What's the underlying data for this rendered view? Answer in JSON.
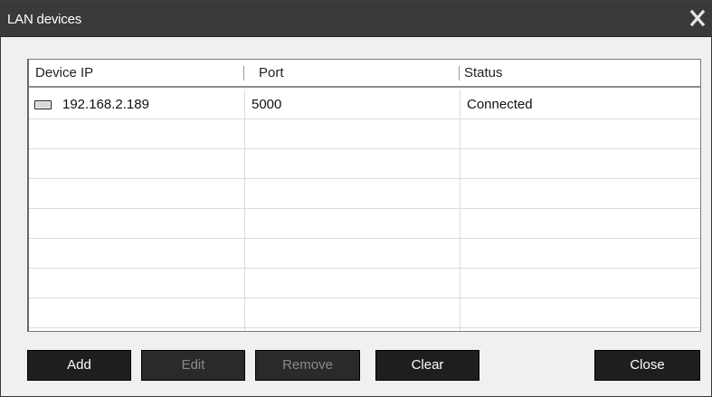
{
  "window": {
    "title": "LAN devices",
    "close_glyph": "X"
  },
  "list": {
    "columns": [
      "Device IP",
      "Port",
      "Status"
    ],
    "rows": [
      {
        "device_ip": "192.168.2.189",
        "port": "5000",
        "status": "Connected",
        "icon": "device-icon"
      }
    ]
  },
  "buttons": {
    "add": "Add",
    "edit": "Edit",
    "remove": "Remove",
    "clear": "Clear",
    "close": "Close"
  },
  "colors": {
    "titlebar": "#3c3c3c",
    "button_bg": "#1e1e1e",
    "button_disabled_text": "#8a8a8a",
    "background": "#f0f0f0"
  }
}
